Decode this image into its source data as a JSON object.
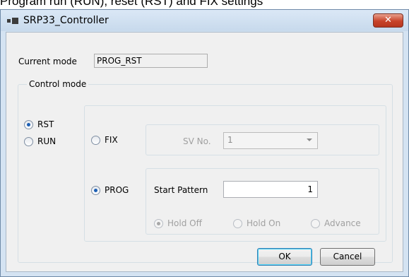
{
  "caption": "Program run (RUN), reset (RST) and FIX settings",
  "window": {
    "title": "SRP33_Controller",
    "close_label": "✕"
  },
  "current_mode": {
    "label": "Current mode",
    "value": "PROG_RST"
  },
  "control_mode": {
    "group_label": "Control mode",
    "rst_label": "RST",
    "run_label": "RUN",
    "selected": "RST"
  },
  "fix": {
    "label": "FIX",
    "sv_label": "SV No.",
    "sv_value": "1"
  },
  "prog": {
    "label": "PROG",
    "start_pattern_label": "Start Pattern",
    "start_pattern_value": "1",
    "hold_off_label": "Hold Off",
    "hold_on_label": "Hold On",
    "advance_label": "Advance"
  },
  "buttons": {
    "ok": "OK",
    "cancel": "Cancel"
  }
}
